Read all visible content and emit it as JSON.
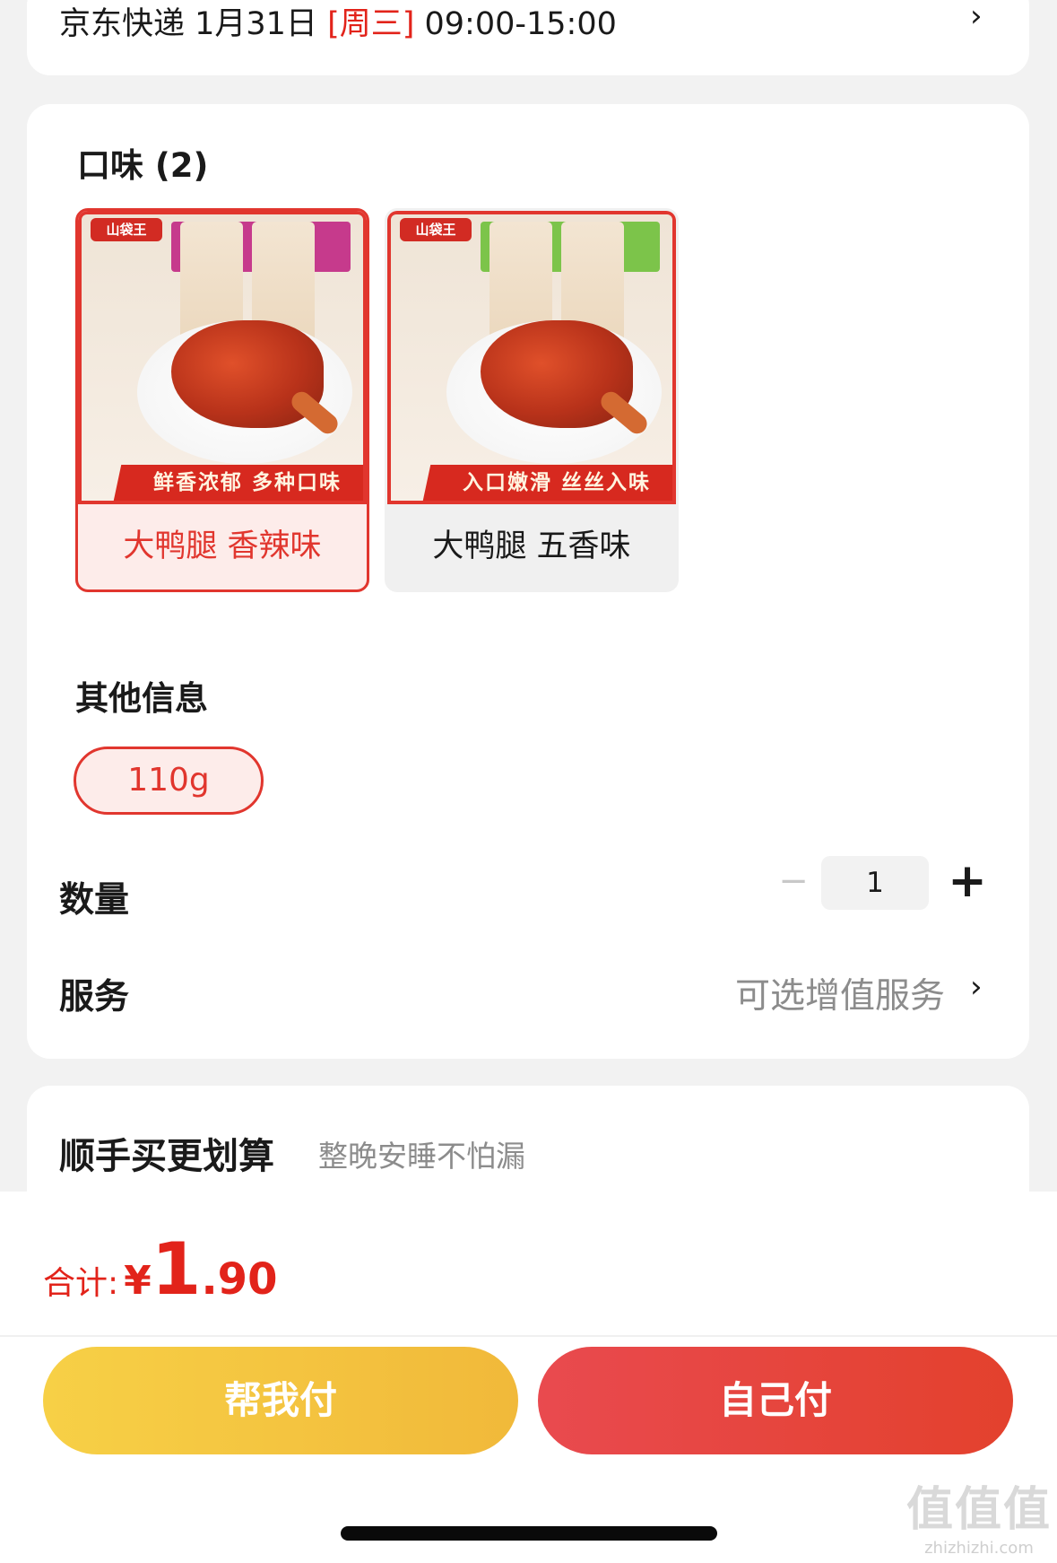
{
  "delivery": {
    "prefix": "京东快递 1月31日 ",
    "day": "[周三]",
    "time": " 09:00-15:00"
  },
  "flavor_section": {
    "title": "口味 (2)",
    "items": [
      {
        "label": "大鸭腿 香辣味",
        "image_tagline": "鲜香浓郁 多种口味",
        "brand": "山袋王",
        "selected": true,
        "band_color": "#c63a8c"
      },
      {
        "label": "大鸭腿 五香味",
        "image_tagline": "入口嫩滑 丝丝入味",
        "brand": "山袋王",
        "selected": false,
        "band_color": "#7cc44a"
      }
    ]
  },
  "other_info": {
    "title": "其他信息",
    "options": [
      "110g"
    ]
  },
  "quantity": {
    "label": "数量",
    "minus": "−",
    "value": "1",
    "plus": "+"
  },
  "service": {
    "label": "服务",
    "value": "可选增值服务",
    "chevron": "›"
  },
  "promo": {
    "title": "顺手买更划算",
    "subtitle": "整晚安睡不怕漏"
  },
  "total": {
    "label": "合计:",
    "currency": "¥",
    "integer": "1",
    "decimal": ".90"
  },
  "buttons": {
    "help_pay": "帮我付",
    "self_pay": "自己付"
  },
  "watermark": {
    "big": "值值值",
    "small": "zhizhizhi.com"
  },
  "colors": {
    "accent_red": "#e2231a",
    "help_pay_yellow": "#f4c540",
    "self_pay_red": "#e5463f"
  }
}
